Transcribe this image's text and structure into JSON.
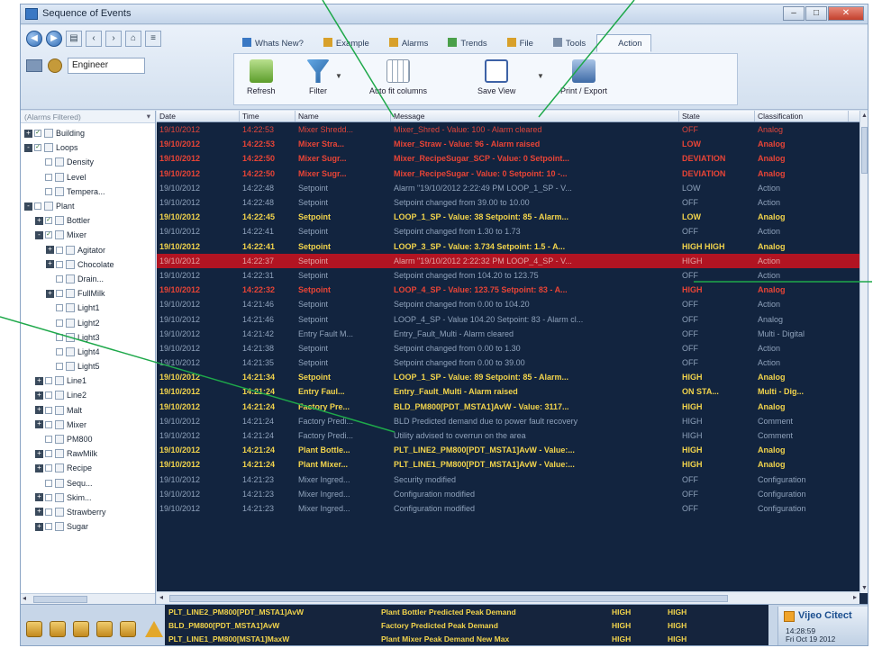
{
  "window": {
    "title": "Sequence of Events"
  },
  "user": {
    "name": "Engineer"
  },
  "ribbon_tabs": [
    {
      "label": "Whats New?",
      "color": "#3a78c4"
    },
    {
      "label": "Example",
      "color": "#d8a02a"
    },
    {
      "label": "Alarms",
      "color": "#d8a02a"
    },
    {
      "label": "Trends",
      "color": "#4aa04a"
    },
    {
      "label": "File",
      "color": "#d8a02a"
    },
    {
      "label": "Tools",
      "color": "#7b8ea8"
    },
    {
      "label": "Action",
      "color": "#f6f9fd"
    }
  ],
  "ribbon_buttons": {
    "refresh": "Refresh",
    "filter": "Filter",
    "auto_columns": "Auto fit columns",
    "save_view": "Save View",
    "print_export": "Print / Export"
  },
  "tree": {
    "header": "(Alarms Filtered)",
    "items": [
      {
        "label": "Building",
        "level": 0,
        "exp": "+",
        "checked": true
      },
      {
        "label": "Loops",
        "level": 0,
        "exp": "-",
        "checked": true
      },
      {
        "label": "Density",
        "level": 1,
        "exp": "",
        "checked": false
      },
      {
        "label": "Level",
        "level": 1,
        "exp": "",
        "checked": false
      },
      {
        "label": "Tempera...",
        "level": 1,
        "exp": "",
        "checked": false
      },
      {
        "label": "Plant",
        "level": 0,
        "exp": "-",
        "checked": false
      },
      {
        "label": "Bottler",
        "level": 1,
        "exp": "+",
        "checked": true
      },
      {
        "label": "Mixer",
        "level": 1,
        "exp": "-",
        "checked": true
      },
      {
        "label": "Agitator",
        "level": 2,
        "exp": "+",
        "checked": false
      },
      {
        "label": "Chocolate",
        "level": 2,
        "exp": "+",
        "checked": false
      },
      {
        "label": "Drain...",
        "level": 2,
        "exp": "",
        "checked": false
      },
      {
        "label": "FullMilk",
        "level": 2,
        "exp": "+",
        "checked": false
      },
      {
        "label": "Light1",
        "level": 2,
        "exp": "",
        "checked": false
      },
      {
        "label": "Light2",
        "level": 2,
        "exp": "",
        "checked": false
      },
      {
        "label": "Light3",
        "level": 2,
        "exp": "",
        "checked": false
      },
      {
        "label": "Light4",
        "level": 2,
        "exp": "",
        "checked": false
      },
      {
        "label": "Light5",
        "level": 2,
        "exp": "",
        "checked": false
      },
      {
        "label": "Line1",
        "level": 1,
        "exp": "+",
        "checked": false
      },
      {
        "label": "Line2",
        "level": 1,
        "exp": "+",
        "checked": false
      },
      {
        "label": "Malt",
        "level": 1,
        "exp": "+",
        "checked": false
      },
      {
        "label": "Mixer",
        "level": 1,
        "exp": "+",
        "checked": false
      },
      {
        "label": "PM800",
        "level": 1,
        "exp": "",
        "checked": false
      },
      {
        "label": "RawMilk",
        "level": 1,
        "exp": "+",
        "checked": false
      },
      {
        "label": "Recipe",
        "level": 1,
        "exp": "+",
        "checked": false
      },
      {
        "label": "Sequ...",
        "level": 1,
        "exp": "",
        "checked": false
      },
      {
        "label": "Skim...",
        "level": 1,
        "exp": "+",
        "checked": false
      },
      {
        "label": "Strawberry",
        "level": 1,
        "exp": "+",
        "checked": false
      },
      {
        "label": "Sugar",
        "level": 1,
        "exp": "+",
        "checked": false
      }
    ]
  },
  "grid": {
    "columns": [
      "Date",
      "Time",
      "Name",
      "Message",
      "State",
      "Classification"
    ],
    "rows": [
      {
        "style": "red",
        "date": "19/10/2012",
        "time": "14:22:53",
        "name": "Mixer Shredd...",
        "message": "Mixer_Shred - Value: 100 - Alarm cleared",
        "state": "OFF",
        "class": "Analog"
      },
      {
        "style": "red-bold",
        "date": "19/10/2012",
        "time": "14:22:53",
        "name": "Mixer Stra...",
        "message": "Mixer_Straw - Value: 96 - Alarm raised",
        "state": "LOW",
        "class": "Analog"
      },
      {
        "style": "red-bold",
        "date": "19/10/2012",
        "time": "14:22:50",
        "name": "Mixer Sugr...",
        "message": "Mixer_RecipeSugar_SCP - Value: 0 Setpoint...",
        "state": "DEVIATION",
        "class": "Analog"
      },
      {
        "style": "red-bold",
        "date": "19/10/2012",
        "time": "14:22:50",
        "name": "Mixer Sugr...",
        "message": "Mixer_RecipeSugar - Value: 0 Setpoint: 10 -...",
        "state": "DEVIATION",
        "class": "Analog"
      },
      {
        "style": "grey",
        "date": "19/10/2012",
        "time": "14:22:48",
        "name": "Setpoint",
        "message": "Alarm \"19/10/2012 2:22:49 PM LOOP_1_SP - V...",
        "state": "LOW",
        "class": "Action"
      },
      {
        "style": "grey",
        "date": "19/10/2012",
        "time": "14:22:48",
        "name": "Setpoint",
        "message": "Setpoint changed from 39.00 to 10.00",
        "state": "OFF",
        "class": "Action"
      },
      {
        "style": "yellow",
        "date": "19/10/2012",
        "time": "14:22:45",
        "name": "Setpoint",
        "message": "LOOP_1_SP - Value: 38 Setpoint: 85 - Alarm...",
        "state": "LOW",
        "class": "Analog"
      },
      {
        "style": "grey",
        "date": "19/10/2012",
        "time": "14:22:41",
        "name": "Setpoint",
        "message": "Setpoint changed from 1.30 to 1.73",
        "state": "OFF",
        "class": "Action"
      },
      {
        "style": "yellow",
        "date": "19/10/2012",
        "time": "14:22:41",
        "name": "Setpoint",
        "message": "LOOP_3_SP - Value: 3.734 Setpoint: 1.5 - A...",
        "state": "HIGH HIGH",
        "class": "Analog"
      },
      {
        "style": "selected",
        "date": "19/10/2012",
        "time": "14:22:37",
        "name": "Setpoint",
        "message": "Alarm \"19/10/2012 2:22:32 PM LOOP_4_SP - V...",
        "state": "HIGH",
        "class": "Action"
      },
      {
        "style": "grey",
        "date": "19/10/2012",
        "time": "14:22:31",
        "name": "Setpoint",
        "message": "Setpoint changed from 104.20 to 123.75",
        "state": "OFF",
        "class": "Action"
      },
      {
        "style": "red-bold",
        "date": "19/10/2012",
        "time": "14:22:32",
        "name": "Setpoint",
        "message": "LOOP_4_SP - Value: 123.75 Setpoint: 83 - A...",
        "state": "HIGH",
        "class": "Analog"
      },
      {
        "style": "grey",
        "date": "19/10/2012",
        "time": "14:21:46",
        "name": "Setpoint",
        "message": "Setpoint changed from 0.00 to 104.20",
        "state": "OFF",
        "class": "Action"
      },
      {
        "style": "grey",
        "date": "19/10/2012",
        "time": "14:21:46",
        "name": "Setpoint",
        "message": "LOOP_4_SP - Value 104.20 Setpoint: 83 - Alarm cl...",
        "state": "OFF",
        "class": "Analog"
      },
      {
        "style": "grey",
        "date": "19/10/2012",
        "time": "14:21:42",
        "name": "Entry Fault M...",
        "message": "Entry_Fault_Multi - Alarm cleared",
        "state": "OFF",
        "class": "Multi - Digital"
      },
      {
        "style": "grey",
        "date": "19/10/2012",
        "time": "14:21:38",
        "name": "Setpoint",
        "message": "Setpoint changed from 0.00 to 1.30",
        "state": "OFF",
        "class": "Action"
      },
      {
        "style": "grey",
        "date": "19/10/2012",
        "time": "14:21:35",
        "name": "Setpoint",
        "message": "Setpoint changed from 0.00 to 39.00",
        "state": "OFF",
        "class": "Action"
      },
      {
        "style": "yellow",
        "date": "19/10/2012",
        "time": "14:21:34",
        "name": "Setpoint",
        "message": "LOOP_1_SP - Value: 89 Setpoint: 85 - Alarm...",
        "state": "HIGH",
        "class": "Analog"
      },
      {
        "style": "yellow",
        "date": "19/10/2012",
        "time": "14:21:24",
        "name": "Entry Faul...",
        "message": "Entry_Fault_Multi - Alarm raised",
        "state": "ON STA...",
        "class": "Multi - Dig..."
      },
      {
        "style": "yellow",
        "date": "19/10/2012",
        "time": "14:21:24",
        "name": "Factory Pre...",
        "message": "BLD_PM800[PDT_MSTA1]AvW - Value: 3117...",
        "state": "HIGH",
        "class": "Analog"
      },
      {
        "style": "grey",
        "date": "19/10/2012",
        "time": "14:21:24",
        "name": "Factory Predi...",
        "message": "BLD Predicted demand due to power fault recovery",
        "state": "HIGH",
        "class": "Comment"
      },
      {
        "style": "grey",
        "date": "19/10/2012",
        "time": "14:21:24",
        "name": "Factory Predi...",
        "message": "Utility advised to overrun on the area",
        "state": "HIGH",
        "class": "Comment"
      },
      {
        "style": "yellow",
        "date": "19/10/2012",
        "time": "14:21:24",
        "name": "Plant Bottle...",
        "message": "PLT_LINE2_PM800[PDT_MSTA1]AvW - Value:...",
        "state": "HIGH",
        "class": "Analog"
      },
      {
        "style": "yellow",
        "date": "19/10/2012",
        "time": "14:21:24",
        "name": "Plant Mixer...",
        "message": "PLT_LINE1_PM800[PDT_MSTA1]AvW - Value:...",
        "state": "HIGH",
        "class": "Analog"
      },
      {
        "style": "grey",
        "date": "19/10/2012",
        "time": "14:21:23",
        "name": "Mixer Ingred...",
        "message": "Security modified",
        "state": "OFF",
        "class": "Configuration"
      },
      {
        "style": "grey",
        "date": "19/10/2012",
        "time": "14:21:23",
        "name": "Mixer Ingred...",
        "message": "Configuration modified",
        "state": "OFF",
        "class": "Configuration"
      },
      {
        "style": "grey",
        "date": "19/10/2012",
        "time": "14:21:23",
        "name": "Mixer Ingred...",
        "message": "Configuration modified",
        "state": "OFF",
        "class": "Configuration"
      }
    ]
  },
  "ticker": [
    {
      "a": "PLT_LINE2_PM800[PDT_MSTA1]AvW",
      "b": "Plant Bottler Predicted Peak Demand",
      "c": "HIGH",
      "d": "HIGH"
    },
    {
      "a": "BLD_PM800[PDT_MSTA1]AvW",
      "b": "Factory Predicted Peak Demand",
      "c": "HIGH",
      "d": "HIGH"
    },
    {
      "a": "PLT_LINE1_PM800[MSTA1]MaxW",
      "b": "Plant Mixer Peak Demand New Max",
      "c": "HIGH",
      "d": "HIGH"
    }
  ],
  "brand": {
    "name": "Vijeo Citect",
    "time": "14:28:59",
    "date": "Fri Oct 19 2012"
  },
  "colors": {
    "grid_bg": "#12243f",
    "alarm_red": "#e0463c",
    "alarm_yellow": "#f2d44c",
    "info_grey": "#8fa2bb",
    "selected_row": "#b21422",
    "annotation_line": "#1ea84a"
  }
}
